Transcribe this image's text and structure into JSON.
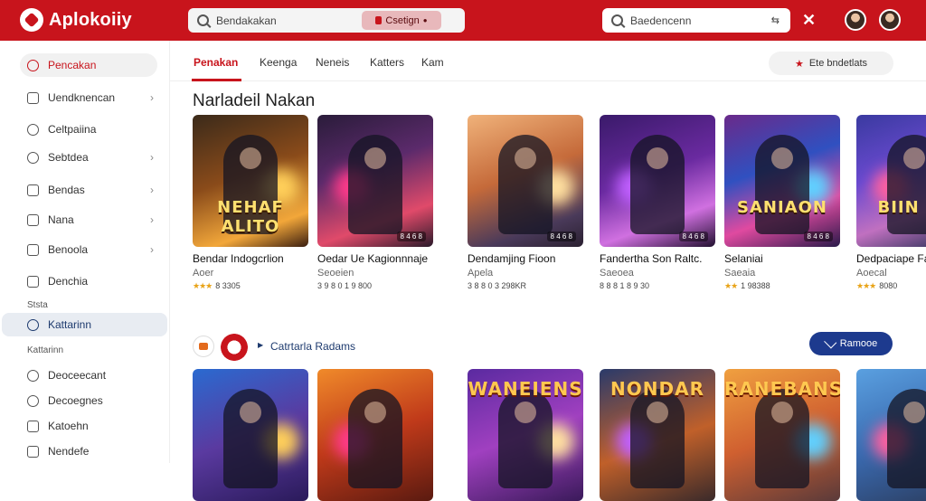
{
  "app": {
    "name": "Aplokoiiy"
  },
  "header": {
    "search_primary": {
      "value": "Bendakakan",
      "button_label": "Csetign"
    },
    "search_secondary": {
      "value": "Baedencenn"
    }
  },
  "sidebar": {
    "items": [
      {
        "label": "Pencakan",
        "icon": "home-icon",
        "state": "active"
      },
      {
        "label": "Uendknencan",
        "icon": "grid-icon",
        "chevron": true
      },
      {
        "label": "Celtpaiina",
        "icon": "people-icon"
      },
      {
        "label": "Sebtdea",
        "icon": "clock-icon",
        "chevron": true
      },
      {
        "label": "Bendas",
        "icon": "bookmark-icon",
        "chevron": true
      },
      {
        "label": "Nana",
        "icon": "folder-icon",
        "chevron": true
      },
      {
        "label": "Benoola",
        "icon": "box-icon",
        "chevron": true
      },
      {
        "label": "Denchia",
        "icon": "box-icon"
      }
    ],
    "section1": "Ststa",
    "highlighted": {
      "label": "Kattarinn",
      "icon": "target-icon"
    },
    "section2": "Kattarinn",
    "items2": [
      {
        "label": "Deoceecant",
        "icon": "chat-icon"
      },
      {
        "label": "Decoegnes",
        "icon": "settings-icon"
      },
      {
        "label": "Katoehn",
        "icon": "tag-icon"
      },
      {
        "label": "Nendefe",
        "icon": "doc-icon"
      }
    ]
  },
  "tabs": [
    {
      "label": "Penakan",
      "active": true
    },
    {
      "label": "Keenga"
    },
    {
      "label": "Neneis"
    },
    {
      "label": "Katters"
    },
    {
      "label": "Kam"
    }
  ],
  "filter_label": "Ete bndetlats",
  "section_title": "Narladeil Nakan",
  "cards_row1": [
    {
      "title": "Bendar Indogcrlion",
      "sub": "Aoer",
      "rating_stars": "★★★",
      "rating_text": "8 3305",
      "badge": "",
      "overlay": "NEHAF ALITO",
      "theme": "amber"
    },
    {
      "title": "Oedar Ue Kagionnnaje",
      "sub": "Seoeien",
      "rating_stars": "",
      "rating_text": "3 9 8 0 1 9 800",
      "badge": "8 4 6 8",
      "overlay": "",
      "theme": "violet"
    },
    {
      "title": "Dendamjing Fioon",
      "sub": "Apela",
      "rating_stars": "",
      "rating_text": "3 8 8 0 3 298KR",
      "badge": "8 4 6 8",
      "overlay": "",
      "theme": "sunset"
    },
    {
      "title": "Fandertha Son Raltc.",
      "sub": "Saeoea",
      "rating_stars": "",
      "rating_text": "8 8 8 1 8 9 30",
      "badge": "8 4 6 8",
      "overlay": "",
      "theme": "purple"
    },
    {
      "title": "Selaniai",
      "sub": "Saeaia",
      "rating_stars": "★★",
      "rating_text": "1 98388",
      "badge": "8 4 6 8",
      "overlay": "SANIAON",
      "theme": "neon"
    },
    {
      "title": "Dedpaciape Fa",
      "sub": "Aoecal",
      "rating_stars": "★★★",
      "rating_text": "8080",
      "badge": "",
      "overlay": "BIIN FC",
      "theme": "city"
    }
  ],
  "row2": {
    "title": "Catrtarla Radams",
    "button_label": "Ramooe",
    "cards": [
      {
        "theme": "blue",
        "overlay": ""
      },
      {
        "theme": "fire",
        "overlay": ""
      },
      {
        "theme": "magic",
        "overlay": "WANEIENS"
      },
      {
        "theme": "dusk",
        "overlay": "NONDAR"
      },
      {
        "theme": "sunset2",
        "overlay": "RANEBANS"
      },
      {
        "theme": "sky",
        "overlay": ""
      }
    ]
  },
  "colors": {
    "brand": "#c8141c",
    "accent_blue": "#1d3a8e"
  }
}
